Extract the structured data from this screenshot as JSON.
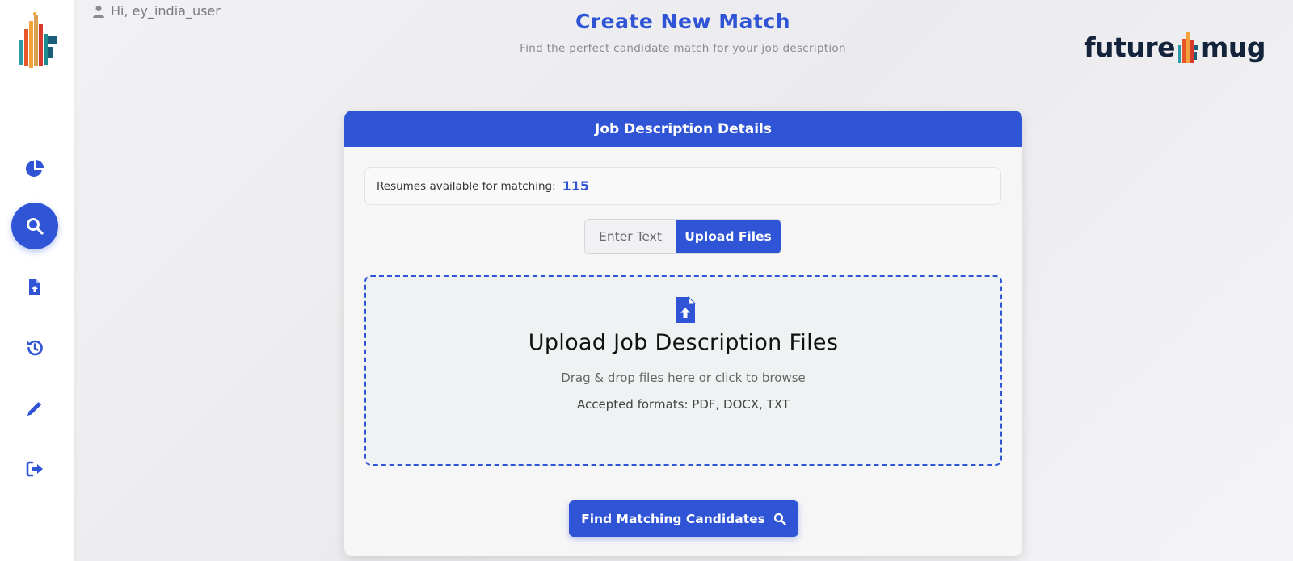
{
  "user": {
    "greeting": "Hi, ey_india_user"
  },
  "header": {
    "title": "Create New Match",
    "subtitle": "Find the perfect candidate match for your job description"
  },
  "brand": {
    "left": "future",
    "right": "mug"
  },
  "sidebar": {
    "items": [
      {
        "icon": "pie-chart-icon",
        "active": false
      },
      {
        "icon": "search-icon",
        "active": true
      },
      {
        "icon": "file-upload-icon",
        "active": false
      },
      {
        "icon": "history-icon",
        "active": false
      },
      {
        "icon": "pencil-icon",
        "active": false
      },
      {
        "icon": "logout-icon",
        "active": false
      }
    ]
  },
  "card": {
    "header": "Job Description Details",
    "resumes_label": "Resumes available for matching:",
    "resumes_count": "115",
    "toggle": {
      "text_label": "Enter Text",
      "upload_label": "Upload Files",
      "selected": "Upload Files"
    },
    "dropzone": {
      "title": "Upload Job Description Files",
      "hint": "Drag & drop files here or click to browse",
      "formats": "Accepted formats: PDF, DOCX, TXT"
    },
    "submit_label": "Find Matching Candidates"
  },
  "colors": {
    "accent": "#2f54d6",
    "brand_text": "#14233c"
  }
}
